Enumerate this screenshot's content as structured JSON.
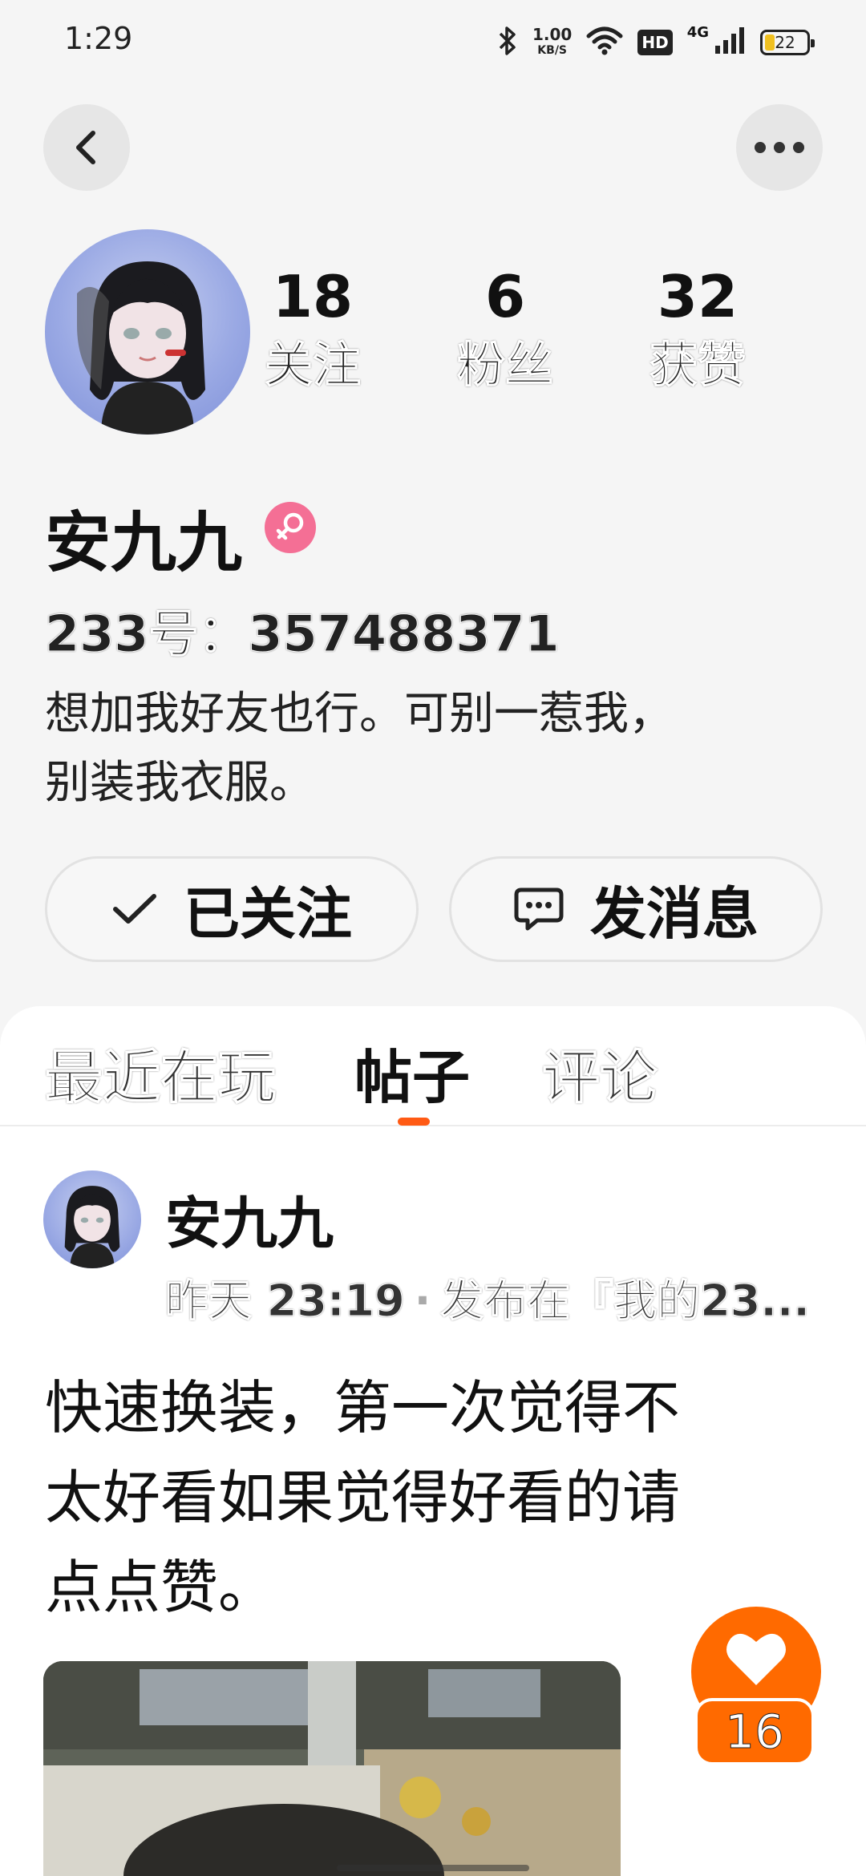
{
  "status_bar": {
    "time": "1:29",
    "speed_value": "1.00",
    "speed_unit": "KB/S",
    "hd": "HD",
    "network": "4G",
    "battery": "22"
  },
  "profile": {
    "name": "安九九",
    "stats": [
      {
        "value": "18",
        "label": "关注"
      },
      {
        "value": "6",
        "label": "粉丝"
      },
      {
        "value": "32",
        "label": "获赞"
      }
    ],
    "uid": "233号：357488371",
    "bio_line1": "想加我好友也行。可别一惹我，",
    "bio_line2": "别装我衣服。",
    "gender_color": "#f46f95"
  },
  "actions": {
    "follow_label": "已关注",
    "message_label": "发消息"
  },
  "tabs": {
    "recent": "最近在玩",
    "posts": "帖子",
    "comments": "评论",
    "active": "posts",
    "accent": "#ff5a14"
  },
  "post": {
    "author": "安九九",
    "time": "昨天 23:19",
    "published_in": "发布在『我的23...",
    "text_line1": "快速换装，第一次觉得不",
    "text_line2": "太好看如果觉得好看的请",
    "text_line3": "点点赞。",
    "likes": "16",
    "like_color": "#ff6a00"
  }
}
